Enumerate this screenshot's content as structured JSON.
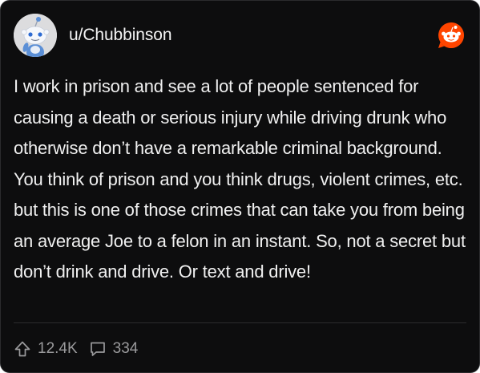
{
  "post": {
    "username": "u/Chubbinson",
    "body": "I work in prison and see a lot of people sentenced for causing a death or serious injury while driving drunk who otherwise don’t have a remarkable criminal background. You think of prison and you think drugs, violent crimes, etc. but this is one of those crimes that can take you from being an average Joe to a felon in an instant. So, not a secret but don’t drink and drive. Or text and drive!",
    "upvotes": "12.4K",
    "comments": "334"
  },
  "icons": {
    "avatar": "snoo-avatar-icon",
    "logo": "reddit-logo-icon",
    "upvote": "upvote-arrow-icon",
    "comment": "comment-bubble-icon"
  },
  "colors": {
    "background": "#0d0d0e",
    "text": "#f0f0f0",
    "muted": "#9a9a9c",
    "brand": "#ff4500"
  }
}
